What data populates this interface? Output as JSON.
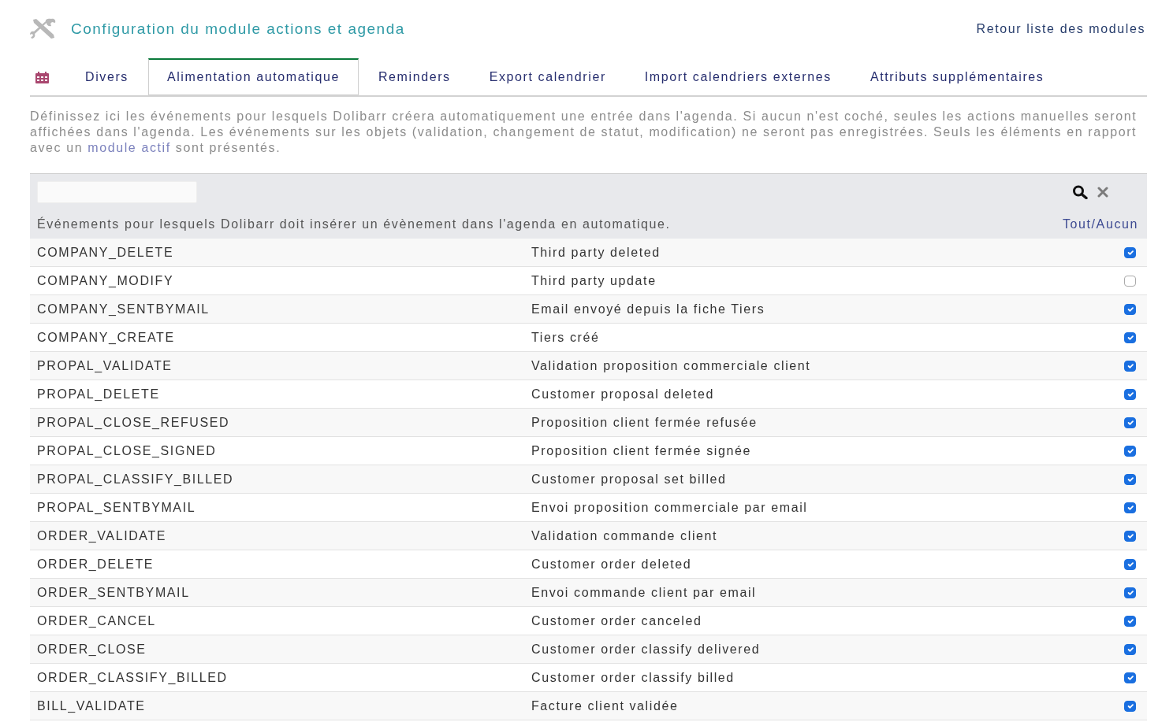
{
  "header": {
    "title": "Configuration du module actions et agenda",
    "back_link": "Retour liste des modules"
  },
  "tabs": [
    {
      "label": "Divers",
      "selected": false
    },
    {
      "label": "Alimentation automatique",
      "selected": true
    },
    {
      "label": "Reminders",
      "selected": false
    },
    {
      "label": "Export calendrier",
      "selected": false
    },
    {
      "label": "Import calendriers externes",
      "selected": false
    },
    {
      "label": "Attributs supplémentaires",
      "selected": false
    }
  ],
  "intro": {
    "text_before": "Définissez ici les événements pour lesquels Dolibarr créera automatiquement une entrée dans l'agenda. Si aucun n'est coché, seules les actions manuelles seront affichées dans l'agenda. Les événements sur les objets (validation, changement de statut, modification) ne seront pas enregistrées. Seuls les éléments en rapport avec un",
    "link": "module actif",
    "text_after": "sont présentés."
  },
  "table": {
    "heading": "Événements pour lesquels Dolibarr doit insérer un évènement dans l'agenda en automatique.",
    "toggle_all": "Tout/Aucun",
    "rows": [
      {
        "code": "COMPANY_DELETE",
        "label": "Third party deleted",
        "checked": true
      },
      {
        "code": "COMPANY_MODIFY",
        "label": "Third party update",
        "checked": false
      },
      {
        "code": "COMPANY_SENTBYMAIL",
        "label": "Email envoyé depuis la fiche Tiers",
        "checked": true
      },
      {
        "code": "COMPANY_CREATE",
        "label": "Tiers créé",
        "checked": true
      },
      {
        "code": "PROPAL_VALIDATE",
        "label": "Validation proposition commerciale client",
        "checked": true
      },
      {
        "code": "PROPAL_DELETE",
        "label": "Customer proposal deleted",
        "checked": true
      },
      {
        "code": "PROPAL_CLOSE_REFUSED",
        "label": "Proposition client fermée refusée",
        "checked": true
      },
      {
        "code": "PROPAL_CLOSE_SIGNED",
        "label": "Proposition client fermée signée",
        "checked": true
      },
      {
        "code": "PROPAL_CLASSIFY_BILLED",
        "label": "Customer proposal set billed",
        "checked": true
      },
      {
        "code": "PROPAL_SENTBYMAIL",
        "label": "Envoi proposition commerciale par email",
        "checked": true
      },
      {
        "code": "ORDER_VALIDATE",
        "label": "Validation commande client",
        "checked": true
      },
      {
        "code": "ORDER_DELETE",
        "label": "Customer order deleted",
        "checked": true
      },
      {
        "code": "ORDER_SENTBYMAIL",
        "label": "Envoi commande client par email",
        "checked": true
      },
      {
        "code": "ORDER_CANCEL",
        "label": "Customer order canceled",
        "checked": true
      },
      {
        "code": "ORDER_CLOSE",
        "label": "Customer order classify delivered",
        "checked": true
      },
      {
        "code": "ORDER_CLASSIFY_BILLED",
        "label": "Customer order classify billed",
        "checked": true
      },
      {
        "code": "BILL_VALIDATE",
        "label": "Facture client validée",
        "checked": true
      }
    ]
  }
}
